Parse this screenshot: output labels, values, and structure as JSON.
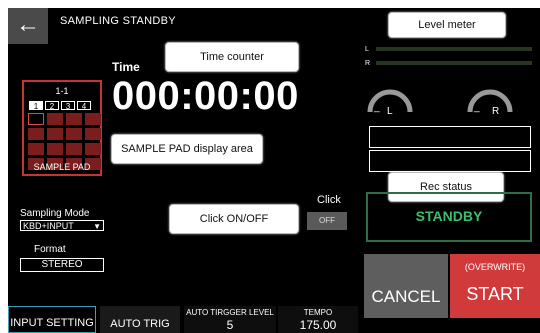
{
  "header": {
    "back_icon": "arrow-left-icon",
    "back_glyph": "←",
    "title": "SAMPLING STANDBY"
  },
  "callouts": {
    "level_meter": "Level meter",
    "time_counter": "Time counter",
    "sample_pad_area": "SAMPLE PAD display area",
    "rec_status": "Rec status",
    "click_onoff": "Click ON/OFF"
  },
  "time": {
    "label": "Time",
    "value": "000:00:00"
  },
  "sample_pad": {
    "bank": "1-1",
    "tabs": [
      "1",
      "2",
      "3",
      "4"
    ],
    "active_tab": "1",
    "label": "SAMPLE PAD"
  },
  "sampling_mode": {
    "label": "Sampling Mode",
    "value": "KBD+INPUT",
    "arrow": "▼"
  },
  "format": {
    "label": "Format",
    "value": "STEREO"
  },
  "click": {
    "label": "Click",
    "state": "OFF"
  },
  "meters": {
    "l_letter": "L",
    "r_letter": "R",
    "left_knob": "L",
    "right_knob": "R",
    "left_prefix": "_",
    "right_prefix": "_",
    "bar_color": "#273520"
  },
  "rec_status": {
    "value": "STANDBY",
    "color": "#3ebd6b"
  },
  "actions": {
    "cancel": "CANCEL",
    "start_sub": "(OVERWRITE)",
    "start": "START",
    "start_color": "#d03a3a"
  },
  "bottom_tabs": {
    "input_setting": "INPUT SETTING",
    "auto_trig": "AUTO TRIG",
    "auto_trigger_level_label": "AUTO TIRGGER LEVEL",
    "auto_trigger_level_value": "5",
    "tempo_label": "TEMPO",
    "tempo_value": "175.00"
  }
}
